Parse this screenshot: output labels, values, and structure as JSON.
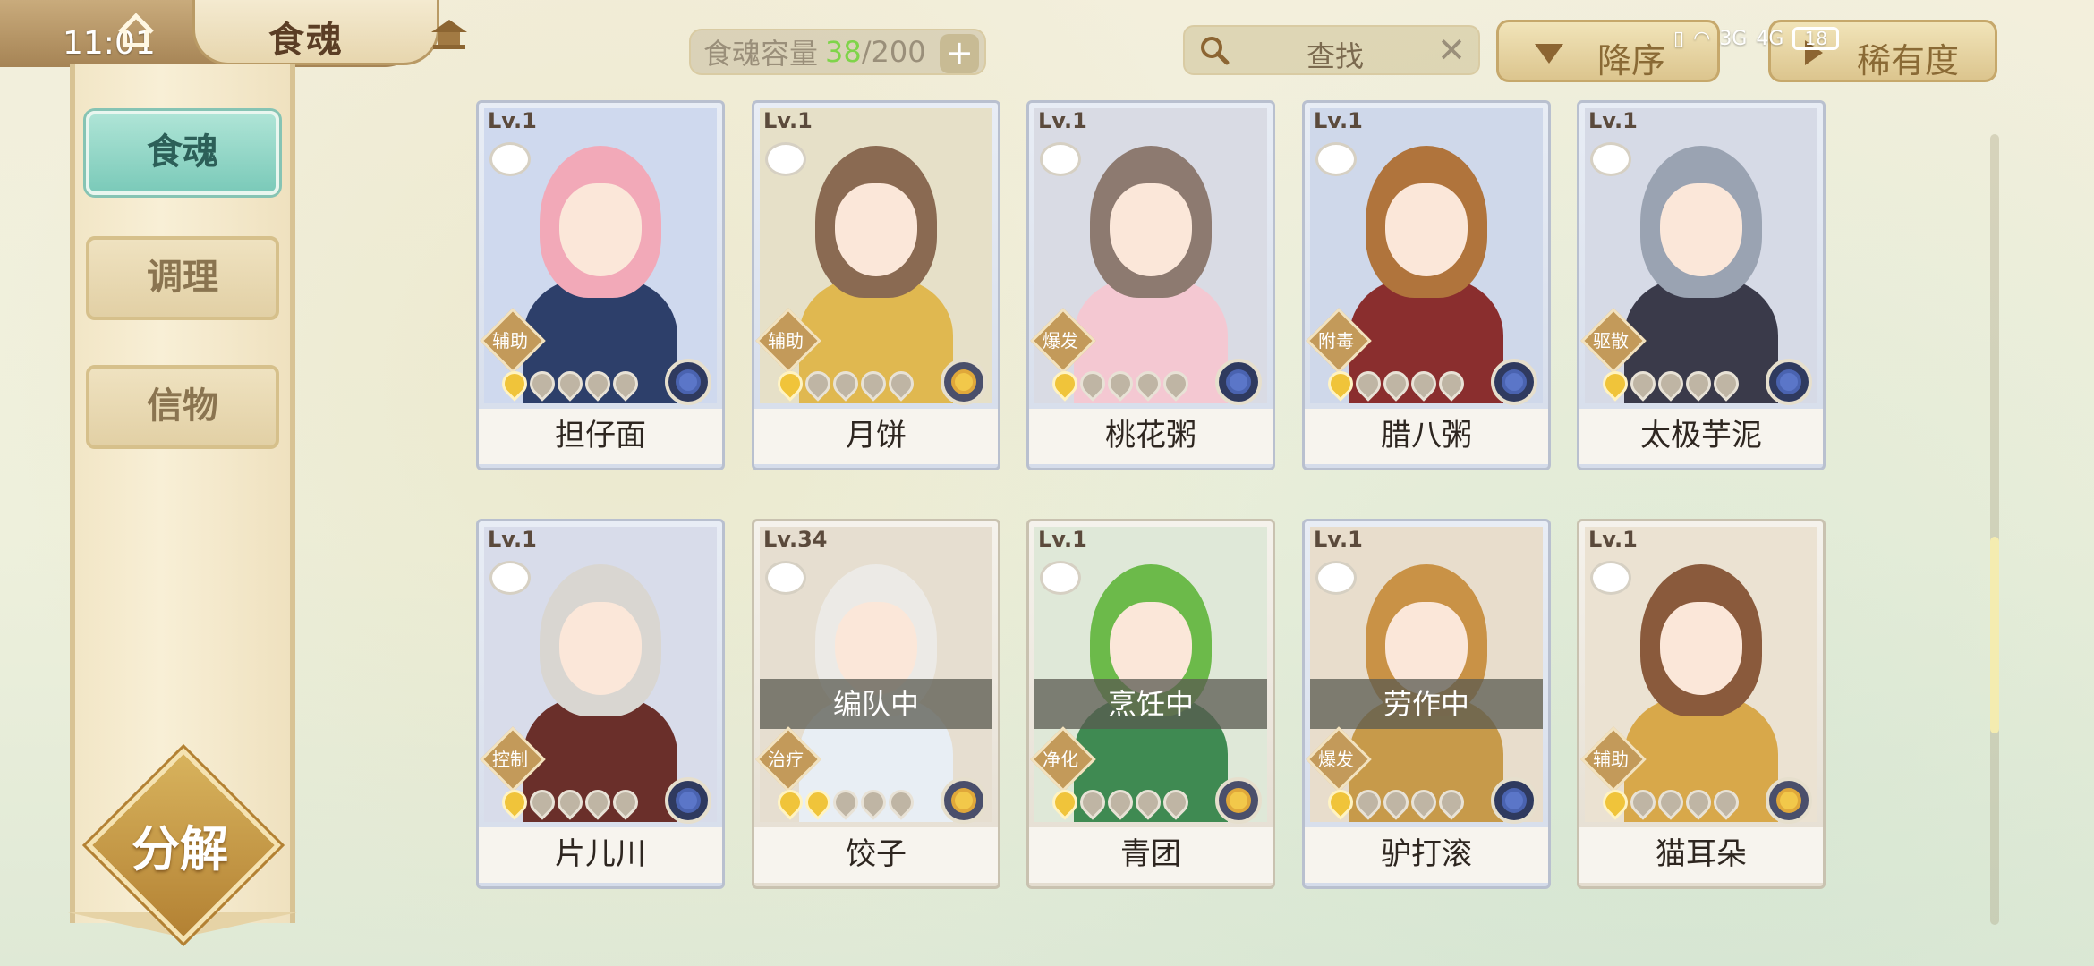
{
  "status_bar": {
    "time": "11:01",
    "network_a": "3G",
    "network_b": "4G",
    "battery": "18"
  },
  "header": {
    "title": "食魂",
    "capacity": {
      "label": "食魂容量",
      "current": "38",
      "separator": "/",
      "max": "200",
      "add_symbol": "+"
    },
    "search": {
      "placeholder": "查找",
      "clear_symbol": "✕"
    },
    "sort_order_label": "降序",
    "sort_key_label": "稀有度"
  },
  "sidebar": {
    "items": [
      {
        "label": "食魂",
        "active": true
      },
      {
        "label": "调理",
        "active": false
      },
      {
        "label": "信物",
        "active": false
      }
    ],
    "decompose_label": "分解"
  },
  "cards": [
    {
      "name": "担仔面",
      "level": "Lv.1",
      "role": "辅助",
      "stars_lit": 1,
      "stars_total": 5,
      "flower": "blue",
      "status": ""
    },
    {
      "name": "月饼",
      "level": "Lv.1",
      "role": "辅助",
      "stars_lit": 1,
      "stars_total": 5,
      "flower": "gold",
      "status": ""
    },
    {
      "name": "桃花粥",
      "level": "Lv.1",
      "role": "爆发",
      "stars_lit": 1,
      "stars_total": 5,
      "flower": "blue",
      "status": ""
    },
    {
      "name": "腊八粥",
      "level": "Lv.1",
      "role": "附毒",
      "stars_lit": 1,
      "stars_total": 5,
      "flower": "blue",
      "status": ""
    },
    {
      "name": "太极芋泥",
      "level": "Lv.1",
      "role": "驱散",
      "stars_lit": 1,
      "stars_total": 5,
      "flower": "blue",
      "status": ""
    },
    {
      "name": "片儿川",
      "level": "Lv.1",
      "role": "控制",
      "stars_lit": 1,
      "stars_total": 5,
      "flower": "blue",
      "status": ""
    },
    {
      "name": "饺子",
      "level": "Lv.34",
      "role": "治疗",
      "stars_lit": 2,
      "stars_total": 5,
      "flower": "gold",
      "status": "编队中"
    },
    {
      "name": "青团",
      "level": "Lv.1",
      "role": "净化",
      "stars_lit": 1,
      "stars_total": 5,
      "flower": "gold",
      "status": "烹饪中"
    },
    {
      "name": "驴打滚",
      "level": "Lv.1",
      "role": "爆发",
      "stars_lit": 1,
      "stars_total": 5,
      "flower": "blue",
      "status": "劳作中"
    },
    {
      "name": "猫耳朵",
      "level": "Lv.1",
      "role": "辅助",
      "stars_lit": 1,
      "stars_total": 5,
      "flower": "gold",
      "status": ""
    }
  ],
  "colors": {
    "accent_teal": "#7bcab9",
    "gold": "#d8b35d",
    "capacity_highlight": "#7fd44a"
  }
}
